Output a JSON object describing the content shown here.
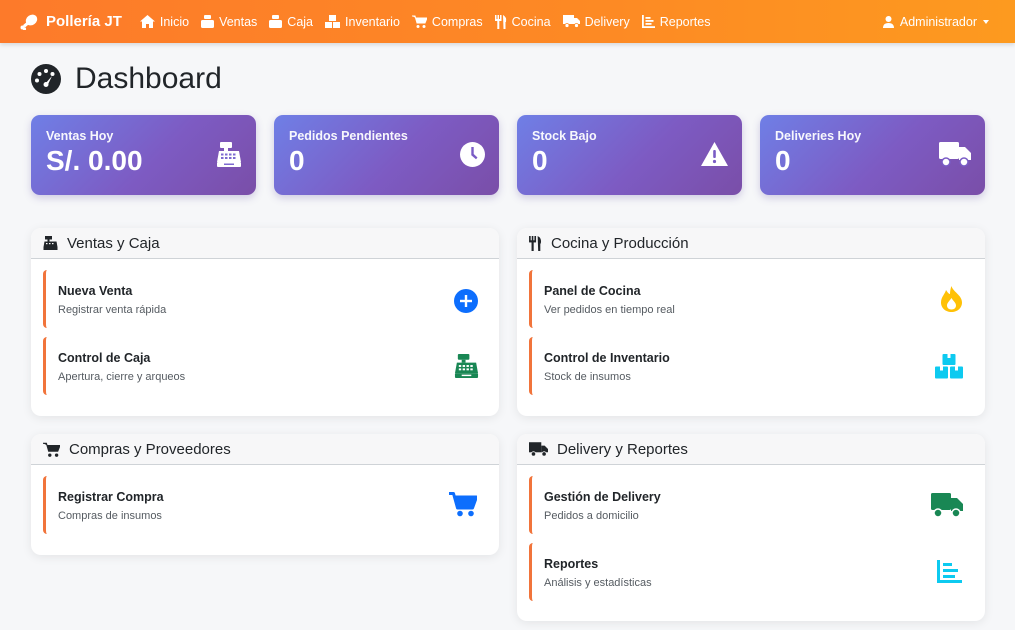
{
  "navbar": {
    "brand": "Pollería JT",
    "items": [
      {
        "label": "Inicio",
        "icon": "home-icon"
      },
      {
        "label": "Ventas",
        "icon": "ventas-icon"
      },
      {
        "label": "Caja",
        "icon": "caja-icon"
      },
      {
        "label": "Inventario",
        "icon": "boxes-icon"
      },
      {
        "label": "Compras",
        "icon": "cart-icon"
      },
      {
        "label": "Cocina",
        "icon": "utensils-icon"
      },
      {
        "label": "Delivery",
        "icon": "truck-icon"
      },
      {
        "label": "Reportes",
        "icon": "chart-icon"
      }
    ],
    "user": "Administrador"
  },
  "page": {
    "title": "Dashboard"
  },
  "stats": [
    {
      "label": "Ventas Hoy",
      "value": "S/. 0.00",
      "icon": "cash-register-icon"
    },
    {
      "label": "Pedidos Pendientes",
      "value": "0",
      "icon": "clock-icon"
    },
    {
      "label": "Stock Bajo",
      "value": "0",
      "icon": "warning-icon"
    },
    {
      "label": "Deliveries Hoy",
      "value": "0",
      "icon": "truck-icon"
    }
  ],
  "panels": {
    "ventas": {
      "title": "Ventas y Caja",
      "items": [
        {
          "title": "Nueva Venta",
          "desc": "Registrar venta rápida"
        },
        {
          "title": "Control de Caja",
          "desc": "Apertura, cierre y arqueos"
        }
      ]
    },
    "cocina": {
      "title": "Cocina y Producción",
      "items": [
        {
          "title": "Panel de Cocina",
          "desc": "Ver pedidos en tiempo real"
        },
        {
          "title": "Control de Inventario",
          "desc": "Stock de insumos"
        }
      ]
    },
    "compras": {
      "title": "Compras y Proveedores",
      "items": [
        {
          "title": "Registrar Compra",
          "desc": "Compras de insumos"
        }
      ]
    },
    "delivery": {
      "title": "Delivery y Reportes",
      "items": [
        {
          "title": "Gestión de Delivery",
          "desc": "Pedidos a domicilio"
        },
        {
          "title": "Reportes",
          "desc": "Análisis y estadísticas"
        }
      ]
    }
  },
  "colors": {
    "navbar": "#fd8a24",
    "stat_gradient_start": "#6f7fe6",
    "stat_gradient_end": "#7a4ea8",
    "item_accent": "#f1743b",
    "icon_blue": "#0d6efd",
    "icon_green": "#198754",
    "icon_yellow": "#ffc107",
    "icon_cyan": "#0dcaf0"
  }
}
